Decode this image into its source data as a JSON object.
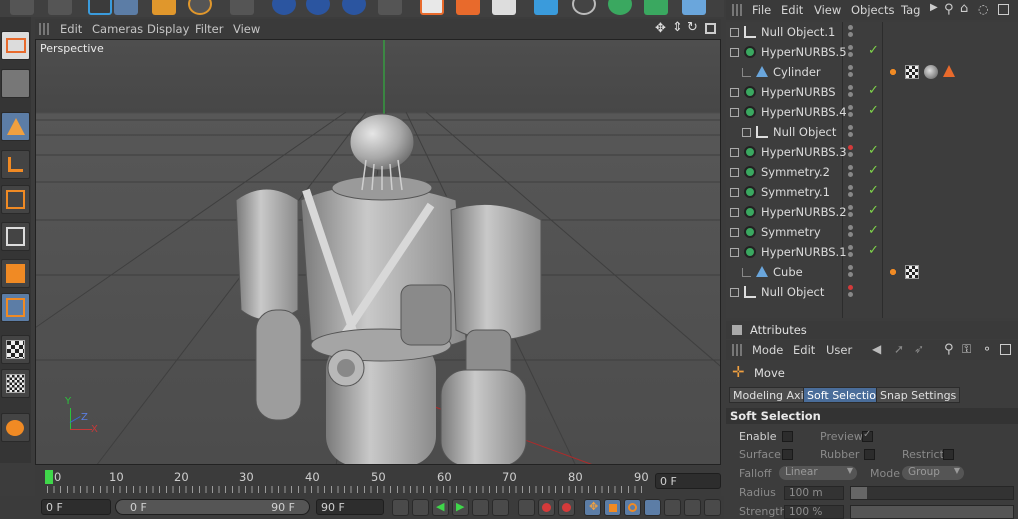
{
  "viewport": {
    "menu": [
      "Edit",
      "Cameras",
      "Display",
      "Filter",
      "View"
    ],
    "label": "Perspective",
    "axis_labels": {
      "x": "X",
      "y": "Y",
      "z": "Z"
    }
  },
  "timeline": {
    "ticks": [
      "0",
      "10",
      "20",
      "30",
      "40",
      "50",
      "60",
      "70",
      "80",
      "90"
    ],
    "current_frame": "0 F",
    "start_field": "0 F",
    "range_min": "0 F",
    "range_max": "90 F",
    "end_field": "90 F"
  },
  "object_manager": {
    "menu": [
      "File",
      "Edit",
      "View",
      "Objects",
      "Tag"
    ],
    "objects": [
      {
        "name": "Null Object.1",
        "icon": "null-icon",
        "check": false
      },
      {
        "name": "HyperNURBS.5",
        "icon": "hypernurbs-icon",
        "check": true
      },
      {
        "name": "Cylinder",
        "icon": "cylinder-icon",
        "check": false,
        "tags": [
          "phong-tag",
          "checker-material-tag",
          "sphere-material-tag",
          "cone-tag"
        ]
      },
      {
        "name": "HyperNURBS",
        "icon": "hypernurbs-icon",
        "check": true
      },
      {
        "name": "HyperNURBS.4",
        "icon": "hypernurbs-icon",
        "check": true
      },
      {
        "name": "Null Object",
        "icon": "null-icon",
        "check": false
      },
      {
        "name": "HyperNURBS.3",
        "icon": "hypernurbs-icon",
        "check": true
      },
      {
        "name": "Symmetry.2",
        "icon": "symmetry-icon",
        "check": true
      },
      {
        "name": "Symmetry.1",
        "icon": "symmetry-icon",
        "check": true
      },
      {
        "name": "HyperNURBS.2",
        "icon": "hypernurbs-icon",
        "check": true
      },
      {
        "name": "Symmetry",
        "icon": "symmetry-icon",
        "check": true
      },
      {
        "name": "HyperNURBS.1",
        "icon": "hypernurbs-icon",
        "check": true
      },
      {
        "name": "Cube",
        "icon": "cube-icon",
        "check": false,
        "tags": [
          "phong-tag",
          "checker-material-tag"
        ]
      },
      {
        "name": "Null Object",
        "icon": "null-icon",
        "check": false
      }
    ]
  },
  "attributes": {
    "title": "Attributes",
    "menu": [
      "Mode",
      "Edit",
      "User"
    ],
    "tool": "Move",
    "tabs": [
      "Modeling Axis",
      "Soft Selection",
      "Snap Settings"
    ],
    "active_tab": "Soft Selection",
    "section": "Soft Selection",
    "fields": {
      "enable": "Enable",
      "preview": "Preview",
      "surface": "Surface",
      "rubber": "Rubber",
      "restrict": "Restrict",
      "falloff": "Falloff",
      "falloff_value": "Linear",
      "mode": "Mode",
      "mode_value": "Group",
      "radius": "Radius",
      "radius_value": "100 m",
      "strength": "Strength",
      "strength_value": "100 %"
    }
  },
  "colors": {
    "accent": "#5c7da6",
    "active_tab": "#4a6d9a",
    "check": "#7fd34a",
    "orange": "#f08a24",
    "playhead": "#3fd74a"
  }
}
